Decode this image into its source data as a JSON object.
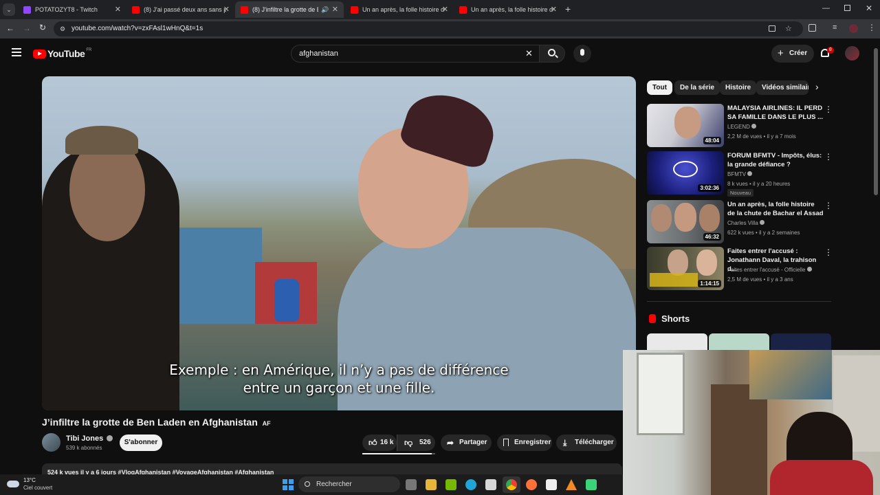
{
  "browser": {
    "tabs": [
      {
        "title": "POTATOZYT8 - Twitch",
        "color": "#9146ff"
      },
      {
        "title": "(8) J'ai passé deux ans sans pap",
        "color": "#ff0000"
      },
      {
        "title": "(8) J'infiltre la grotte de Ben",
        "color": "#ff0000"
      },
      {
        "title": "Un an après, la folle histoire de",
        "color": "#ff0000"
      },
      {
        "title": "Un an après, la folle histoire de",
        "color": "#ff0000"
      }
    ],
    "active_tab_index": 2,
    "url": "youtube.com/watch?v=zxFAsl1wHnQ&t=1s"
  },
  "youtube": {
    "logo_text": "YouTube",
    "region": "FR",
    "search_value": "afghanistan",
    "create_label": "Créer",
    "notification_count": "8"
  },
  "video": {
    "caption_line1": "Exemple : en Amérique, il n’y a pas de différence",
    "caption_line2": "entre un garçon et une fille.",
    "title": "J’infiltre la grotte de Ben Laden en Afghanistan",
    "title_badge": "AF",
    "channel": "Tibi Jones",
    "subscribers": "539 k abonnés",
    "subscribe_label": "S'abonner",
    "likes": "16 k",
    "dislikes": "526",
    "share_label": "Partager",
    "save_label": "Enregistrer",
    "download_label": "Télécharger",
    "description_line": "524 k vues  il y a 6 jours  #VlogAfghanistan #VoyageAfghanistan #Afghanistan"
  },
  "sidebar": {
    "chips": [
      "Tout",
      "De la série",
      "Histoire",
      "Vidéos similaires"
    ],
    "recommendations": [
      {
        "title": "MALAYSIA AIRLINES: IL PERD SA FAMILLE DANS LE PLUS ...",
        "channel": "LEGEND",
        "views": "2,2 M de vues",
        "age": "il y a 7 mois",
        "duration": "48:04",
        "thumb_color": "#c9c9d1"
      },
      {
        "title": "FORUM BFMTV - Impôts, élus: la grande défiance ?",
        "channel": "BFMTV",
        "views": "8 k vues",
        "age": "il y a 20 heures",
        "duration": "3:02:36",
        "badge": "Nouveau",
        "thumb_color": "#1b1f7a"
      },
      {
        "title": "Un an après, la folle histoire de la chute de Bachar el Assad",
        "channel": "Charles Villa",
        "views": "622 k vues",
        "age": "il y a 2 semaines",
        "duration": "46:32",
        "thumb_color": "#6a6f72"
      },
      {
        "title": "Faites entrer l'accusé : Jonathann Daval, la trahison d...",
        "channel": "Faites entrer l'accusé - Officielle",
        "views": "2,5 M de vues",
        "age": "il y a 3 ans",
        "duration": "1:14:15",
        "thumb_color": "#4a4a3a"
      }
    ],
    "shorts_label": "Shorts"
  },
  "taskbar": {
    "weather_temp": "13°C",
    "weather_desc": "Ciel couvert",
    "search_label": "Rechercher"
  }
}
